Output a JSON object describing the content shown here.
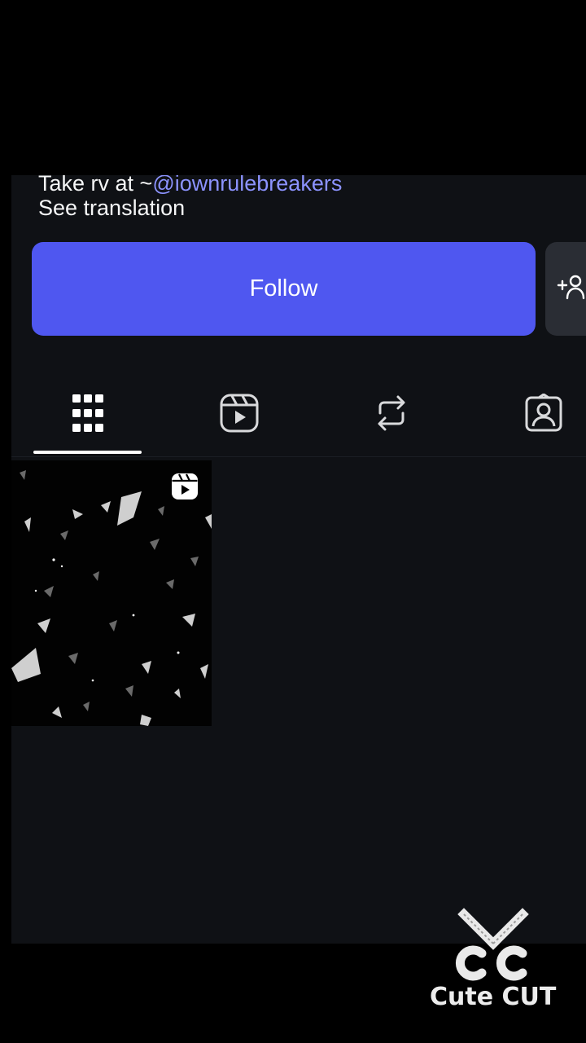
{
  "profile": {
    "bio_prefix": "Take rv at ~",
    "bio_mention": "@iownrulebreakers",
    "see_translation": "See translation"
  },
  "actions": {
    "follow_label": "Follow",
    "suggest_icon": "add-person-icon",
    "accent_color": "#4f57f0"
  },
  "tabs": [
    {
      "id": "posts",
      "icon": "grid-icon",
      "active": true
    },
    {
      "id": "reels",
      "icon": "reels-icon",
      "active": false
    },
    {
      "id": "reposts",
      "icon": "repost-icon",
      "active": false
    },
    {
      "id": "tagged",
      "icon": "tagged-person-icon",
      "active": false
    }
  ],
  "grid": {
    "items": [
      {
        "type": "reel",
        "badge_icon": "reels-icon"
      }
    ]
  },
  "watermark": {
    "text": "Cute CUT"
  }
}
